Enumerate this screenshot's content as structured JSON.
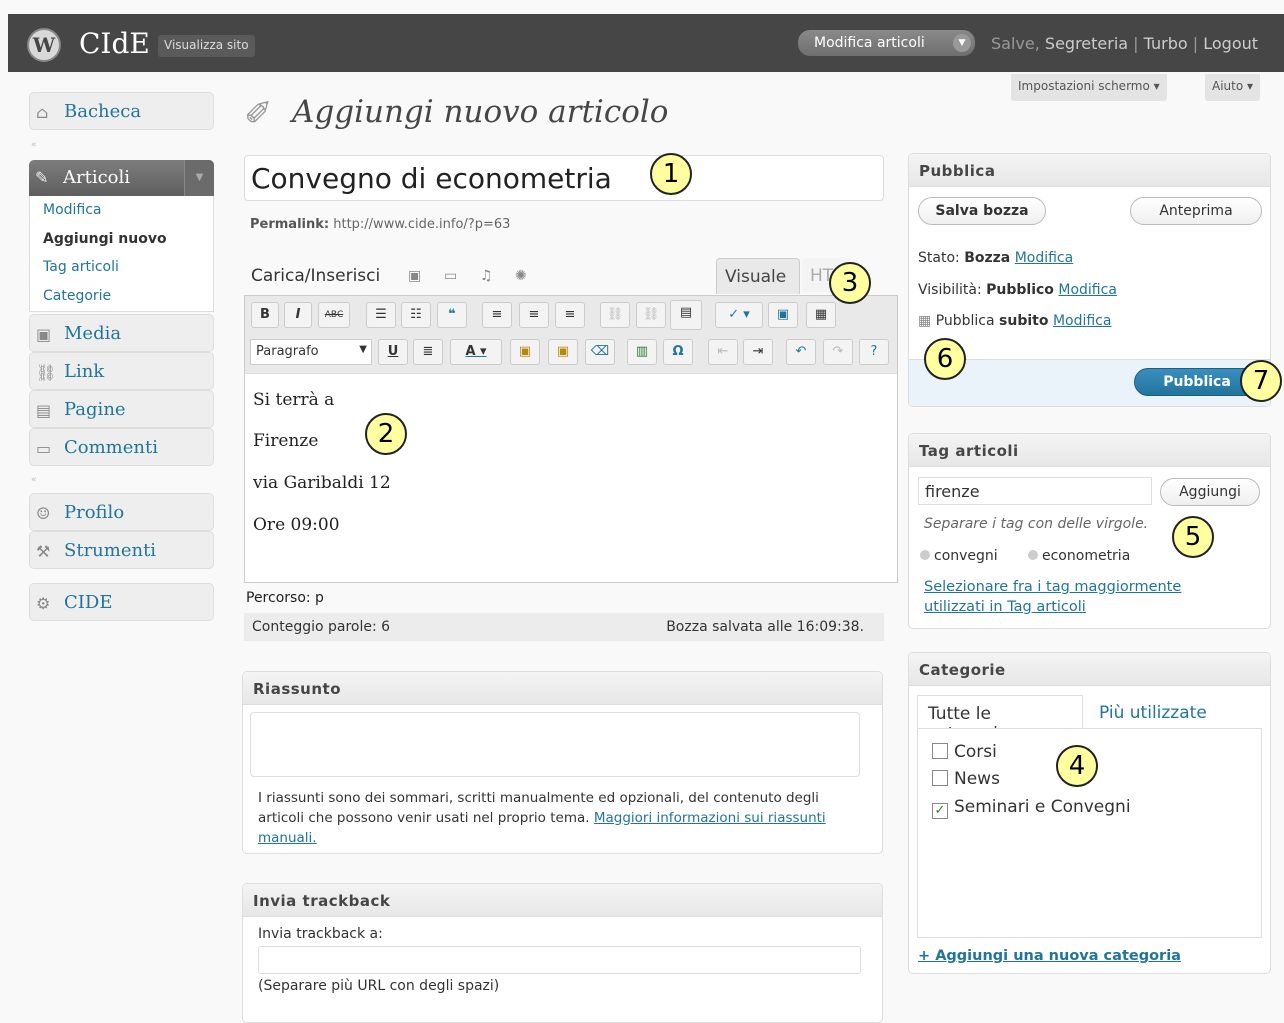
{
  "header": {
    "site_title": "CIdE",
    "view_site": "Visualizza sito",
    "favorite_action": "Modifica articoli",
    "greeting": "Salve,",
    "user": "Segreteria",
    "sep": "|",
    "turbo": "Turbo",
    "logout": "Logout"
  },
  "screen_options": "Impostazioni schermo",
  "help": "Aiuto",
  "menu": {
    "dashboard": "Bacheca",
    "posts": "Articoli",
    "posts_sub": [
      "Modifica",
      "Aggiungi nuovo",
      "Tag articoli",
      "Categorie"
    ],
    "media": "Media",
    "links": "Link",
    "pages": "Pagine",
    "comments": "Commenti",
    "profile": "Profilo",
    "tools": "Strumenti",
    "cide": "CIDE"
  },
  "page_title": "Aggiungi nuovo articolo",
  "post": {
    "title": "Convegno di econometria",
    "permalink_label": "Permalink:",
    "permalink_url": "http://www.cide.info/?p=63",
    "upload_label": "Carica/Inserisci",
    "tab_visual": "Visuale",
    "tab_html": "HTML",
    "format": "Paragrafo",
    "content_lines": [
      "Si terrà a",
      "Firenze",
      "via Garibaldi 12",
      "Ore 09:00"
    ],
    "path": "Percorso: p",
    "word_count": "Conteggio parole: 6",
    "autosave": "Bozza salvata alle 16:09:38."
  },
  "excerpt": {
    "title": "Riassunto",
    "help": "I riassunti sono dei sommari, scritti manualmente ed opzionali, del contenuto degli articoli che possono venir usati nel proprio tema.",
    "help_link": "Maggiori informazioni sui riassunti manuali."
  },
  "trackback": {
    "title": "Invia trackback",
    "label": "Invia trackback a:",
    "help": "(Separare più URL con degli spazi)"
  },
  "publish": {
    "title": "Pubblica",
    "save_draft": "Salva bozza",
    "preview": "Anteprima",
    "status_label": "Stato:",
    "status_value": "Bozza",
    "visibility_label": "Visibilità:",
    "visibility_value": "Pubblico",
    "publish_label": "Pubblica",
    "publish_value": "subito",
    "edit": "Modifica",
    "publish_button": "Pubblica"
  },
  "tags": {
    "title": "Tag articoli",
    "input_value": "firenze",
    "add": "Aggiungi",
    "help": "Separare i tag con delle virgole.",
    "chips": [
      "convegni",
      "econometria"
    ],
    "cloud_link": "Selezionare fra i tag maggiormente utilizzati in Tag articoli"
  },
  "categories": {
    "title": "Categorie",
    "tab_all": "Tutte le categorie",
    "tab_popular": "Più utilizzate",
    "items": [
      {
        "label": "Corsi",
        "checked": false
      },
      {
        "label": "News",
        "checked": false
      },
      {
        "label": "Seminari e Convegni",
        "checked": true
      }
    ],
    "add_new": "+ Aggiungi una nuova categoria"
  },
  "callouts": [
    "1",
    "2",
    "3",
    "4",
    "5",
    "6",
    "7"
  ],
  "colors": {
    "header_bg": "#464646",
    "link": "#21759b",
    "publish": "#21759b",
    "callout": "#ffffa0"
  }
}
